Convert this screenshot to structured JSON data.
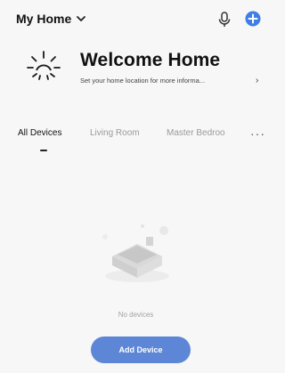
{
  "header": {
    "home_name": "My Home",
    "icons": [
      "chevron-down-icon",
      "microphone-icon",
      "add-circle-icon"
    ]
  },
  "welcome": {
    "title": "Welcome Home",
    "subtitle": "Set your home location for more informa...",
    "chevron": "›",
    "icon": "sun-icon"
  },
  "tabs": [
    {
      "label": "All Devices",
      "active": true
    },
    {
      "label": "Living Room",
      "active": false
    },
    {
      "label": "Master Bedroo",
      "active": false
    }
  ],
  "more_label": "···",
  "empty": {
    "text": "No devices",
    "illustration": "empty-house-illustration"
  },
  "add_device_label": "Add Device",
  "colors": {
    "accent": "#5d87d6",
    "background": "#f7f7f7",
    "inactive_tab": "#9a9a9a"
  }
}
